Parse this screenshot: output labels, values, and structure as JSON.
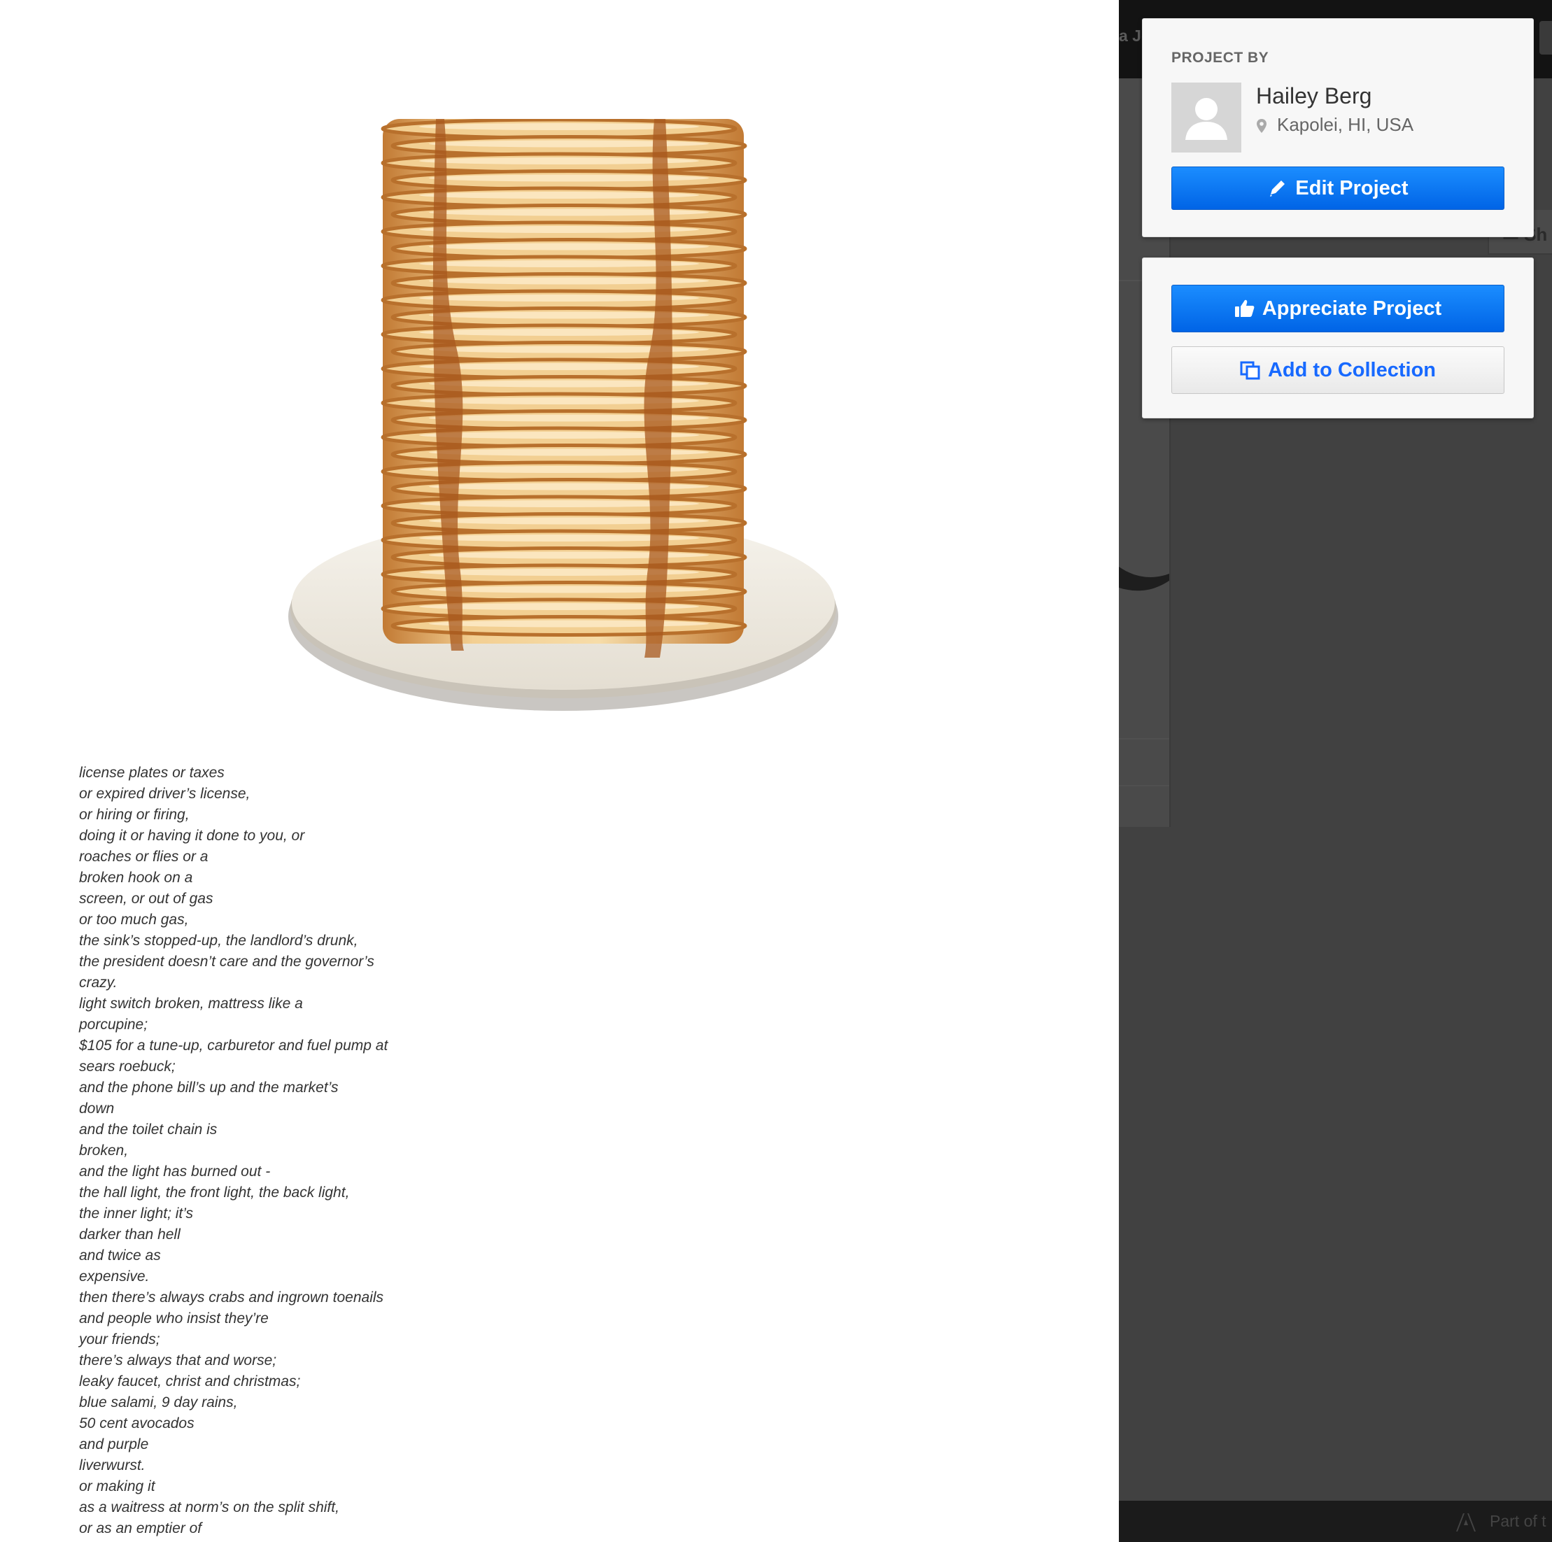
{
  "project_owner": {
    "label": "PROJECT BY",
    "name": "Hailey Berg",
    "location": "Kapolei, HI, USA",
    "edit_button": "Edit Project"
  },
  "actions": {
    "appreciate_button": "Appreciate Project",
    "collection_button": "Add to Collection"
  },
  "background_page": {
    "top_bar_partial_text": "a Jo",
    "share_partial_text": "Sh",
    "footer_partial_text": "Part of t"
  },
  "poem": {
    "lines": [
      "license plates or taxes",
      "or expired driver’s license,",
      "or hiring or firing,",
      "doing it or having it done to you, or",
      "roaches or flies or a",
      "broken hook on a",
      "screen, or out of gas",
      "or too much gas,",
      "the sink’s stopped-up, the landlord’s drunk,",
      "the president doesn’t care and the governor’s",
      "crazy.",
      "light switch broken, mattress like a",
      "porcupine;",
      "$105 for a tune-up, carburetor and fuel pump at",
      "sears roebuck;",
      "and the phone bill’s up and the market’s",
      "down",
      "and the toilet chain is",
      "broken,",
      "and the light has burned out -",
      "the hall light, the front light, the back light,",
      "the inner light; it’s",
      "darker than hell",
      "and twice as",
      "expensive.",
      "then there’s always crabs and ingrown toenails",
      "and people who insist they’re",
      "your friends;",
      "there’s always that and worse;",
      "leaky faucet, christ and christmas;",
      "blue salami, 9 day rains,",
      "50 cent avocados",
      "and purple",
      "liverwurst.",
      "or making it",
      "as a waitress at norm’s on the split shift,",
      "or as an emptier of"
    ]
  },
  "colors": {
    "primary_blue": "#0a74f5",
    "dark_panel": "#414141",
    "syrup": "#a8581e",
    "pancake": "#f2cf92"
  },
  "icons": {
    "edit": "pencil-icon",
    "appreciate": "thumbs-up-icon",
    "collection": "collection-icon",
    "location": "map-pin-icon",
    "avatar": "user-silhouette-icon"
  }
}
